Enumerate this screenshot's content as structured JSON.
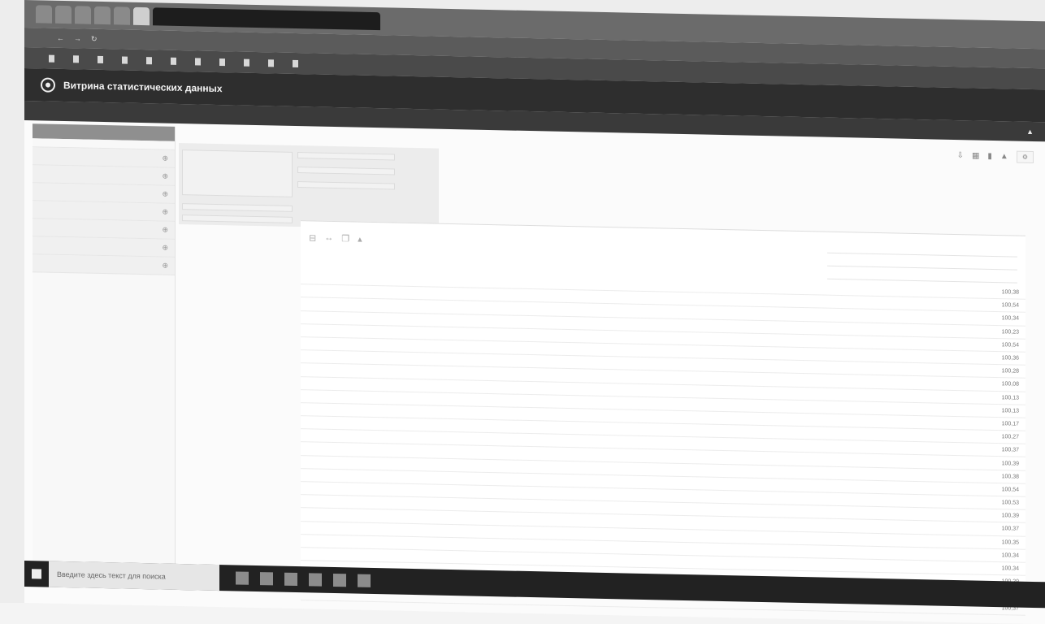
{
  "browser": {
    "tabs": [
      "",
      "",
      "",
      "",
      "",
      ""
    ],
    "address": ""
  },
  "bookmarks": [
    "",
    "",
    "",
    "",
    "",
    "",
    "",
    "",
    "",
    "",
    ""
  ],
  "app": {
    "title": "Витрина статистических данных"
  },
  "userbar": {
    "items": [
      "",
      "",
      "",
      ""
    ]
  },
  "sidebar": {
    "header": "",
    "rows": [
      "",
      "",
      "",
      "",
      "",
      "",
      "",
      ""
    ]
  },
  "pivot": {
    "cells": [
      "",
      "",
      "",
      "",
      "",
      "",
      ""
    ]
  },
  "notice": "",
  "grid": {
    "header_lines": [
      "",
      "",
      ""
    ],
    "rows": [
      [
        "",
        "100,38"
      ],
      [
        "",
        "100,54"
      ],
      [
        "",
        "100,34"
      ],
      [
        "",
        "100,23"
      ],
      [
        "",
        "100,54"
      ],
      [
        "",
        "100,36"
      ],
      [
        "",
        "100,28"
      ],
      [
        "",
        "100,08"
      ],
      [
        "",
        "100,13"
      ],
      [
        "",
        "100,13"
      ],
      [
        "",
        "100,17"
      ],
      [
        "",
        "100,27"
      ],
      [
        "",
        "100,37"
      ],
      [
        "",
        "100,39"
      ],
      [
        "",
        "100,38"
      ],
      [
        "",
        "100,54"
      ],
      [
        "",
        "100,53"
      ],
      [
        "",
        "100,39"
      ],
      [
        "",
        "100,37"
      ],
      [
        "",
        "100,35"
      ],
      [
        "",
        "100,34"
      ],
      [
        "",
        "100,34"
      ],
      [
        "",
        "100,29"
      ],
      [
        "",
        "100,34"
      ],
      [
        "",
        "100,37"
      ]
    ]
  },
  "taskbar": {
    "search": "Введите здесь текст для поиска",
    "time": ""
  }
}
